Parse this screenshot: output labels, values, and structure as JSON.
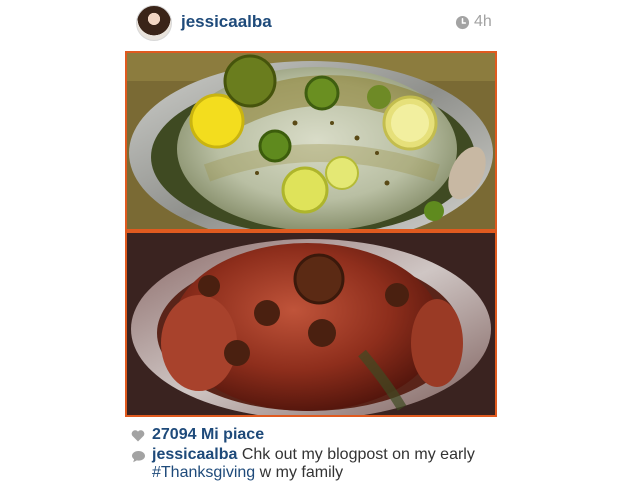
{
  "post": {
    "username": "jessicaalba",
    "time": "4h",
    "likes_count": "27094",
    "likes_label": "Mi piace",
    "caption": {
      "user": "jessicaalba",
      "text_before": " Chk out my blogpost on my early ",
      "hashtag": "#Thanksgiving",
      "text_after": " w my family"
    }
  },
  "colors": {
    "link": "#1e4a7a",
    "muted": "#a3a3a3",
    "photo_frame": "#e05a1f"
  },
  "icons": {
    "time": "clock-icon",
    "likes": "heart-icon",
    "comments": "comment-bubble-icon"
  }
}
